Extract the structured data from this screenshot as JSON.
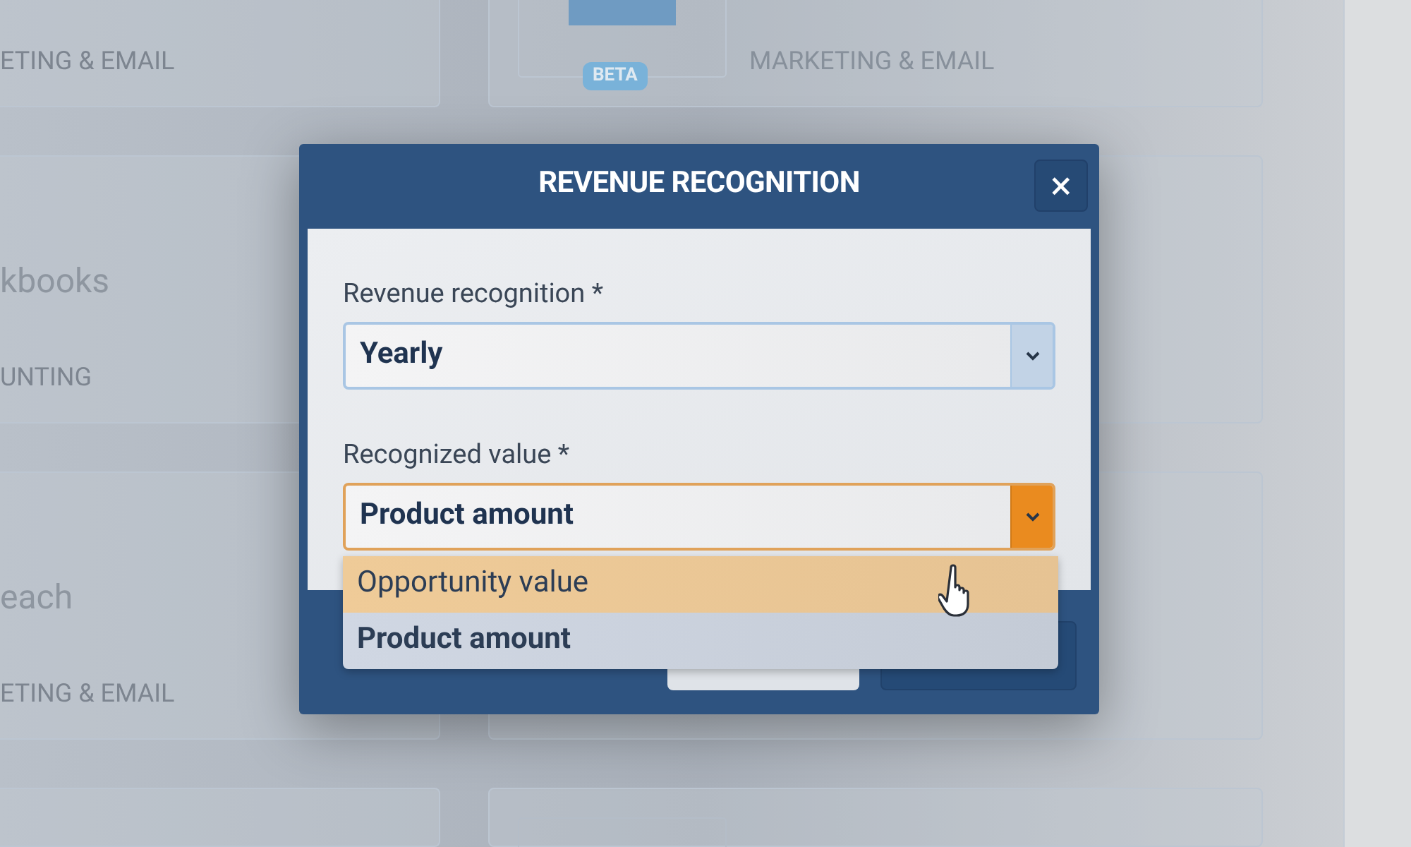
{
  "left_cards": [
    {
      "category": "ETING & EMAIL"
    },
    {
      "title": "kbooks",
      "category": "UNTING"
    },
    {
      "title": "each",
      "category": "ETING & EMAIL"
    }
  ],
  "right_cards": [
    {
      "badge": "BETA",
      "category": "MARKETING & EMAIL"
    }
  ],
  "dialog": {
    "title": "REVENUE RECOGNITION",
    "close": "×",
    "fields": [
      {
        "label": "Revenue recognition *",
        "value": "Yearly",
        "open": false
      },
      {
        "label": "Recognized value *",
        "value": "Product amount",
        "open": true,
        "options": [
          {
            "label": "Opportunity value",
            "selected": false,
            "hovered": true
          },
          {
            "label": "Product amount",
            "selected": true,
            "hovered": false
          }
        ]
      }
    ]
  }
}
